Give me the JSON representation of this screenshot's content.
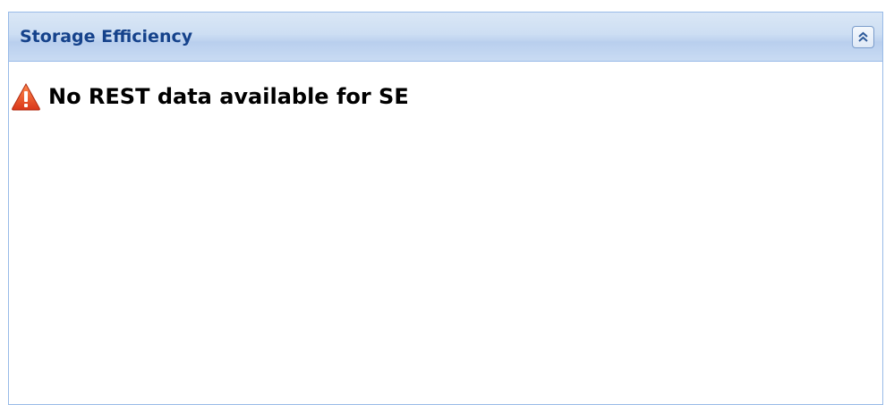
{
  "panel": {
    "title": "Storage Efficiency",
    "collapse_icon": "double-chevron-up-icon"
  },
  "message": {
    "icon": "warning-icon",
    "text": "No REST data available for SE"
  },
  "colors": {
    "title": "#15428b",
    "border": "#99bbe8",
    "warning": "#e8461c"
  }
}
